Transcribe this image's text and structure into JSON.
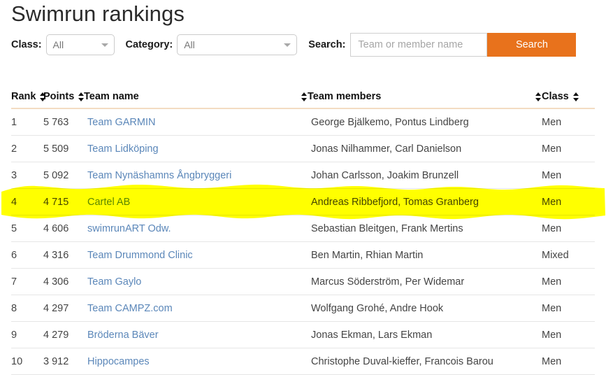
{
  "page": {
    "title": "Swimrun rankings"
  },
  "filters": {
    "class_label": "Class:",
    "class_value": "All",
    "category_label": "Category:",
    "category_value": "All",
    "search_label": "Search:",
    "search_placeholder": "Team or member name",
    "search_value": "",
    "search_button": "Search",
    "accent_color": "#e8721c",
    "link_color": "#5b87b9",
    "highlight_color": "#ffff00"
  },
  "table": {
    "headers": {
      "rank": "Rank",
      "points": "Points",
      "team_name": "Team name",
      "team_members": "Team members",
      "class": "Class"
    },
    "rows": [
      {
        "rank": "1",
        "points": "5 763",
        "team": "Team GARMIN",
        "members": "George Bjälkemo, Pontus Lindberg",
        "class": "Men",
        "highlighted": false
      },
      {
        "rank": "2",
        "points": "5 509",
        "team": "Team Lidköping",
        "members": "Jonas Nilhammer, Carl Danielson",
        "class": "Men",
        "highlighted": false
      },
      {
        "rank": "3",
        "points": "5 092",
        "team": "Team Nynäshamns Ångbryggeri",
        "members": "Johan Carlsson, Joakim Brunzell",
        "class": "Men",
        "highlighted": false
      },
      {
        "rank": "4",
        "points": "4 715",
        "team": "Cartel AB",
        "members": "Andreas Ribbefjord, Tomas Granberg",
        "class": "Men",
        "highlighted": true
      },
      {
        "rank": "5",
        "points": "4 606",
        "team": "swimrunART Odw.",
        "members": "Sebastian Bleitgen, Frank Mertins",
        "class": "Men",
        "highlighted": false
      },
      {
        "rank": "6",
        "points": "4 316",
        "team": "Team Drummond Clinic",
        "members": "Ben Martin, Rhian Martin",
        "class": "Mixed",
        "highlighted": false
      },
      {
        "rank": "7",
        "points": "4 306",
        "team": "Team Gaylo",
        "members": "Marcus Söderström, Per Widemar",
        "class": "Men",
        "highlighted": false
      },
      {
        "rank": "8",
        "points": "4 297",
        "team": "Team CAMPZ.com",
        "members": "Wolfgang Grohé, Andre Hook",
        "class": "Men",
        "highlighted": false
      },
      {
        "rank": "9",
        "points": "4 279",
        "team": "Bröderna Bäver",
        "members": "Jonas Ekman, Lars Ekman",
        "class": "Men",
        "highlighted": false
      },
      {
        "rank": "10",
        "points": "3 912",
        "team": "Hippocampes",
        "members": "Christophe Duval-kieffer, Francois Barou",
        "class": "Men",
        "highlighted": false
      }
    ]
  }
}
